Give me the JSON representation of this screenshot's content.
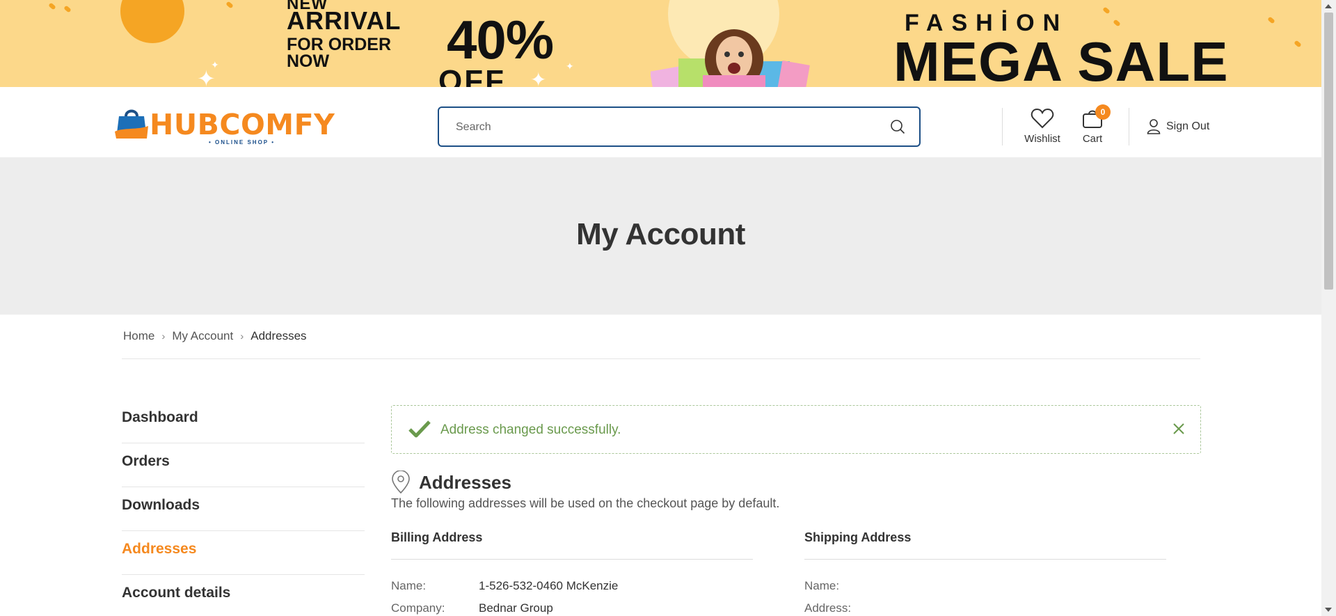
{
  "banner": {
    "new_text": "NEW",
    "arrival_text": "ARRIVAL",
    "for_order_text": "FOR ORDER NOW",
    "percent_text": "40%",
    "off_text": "OFF",
    "fashion_text": "FASHİON",
    "mega_sale_text": "MEGA SALE"
  },
  "header": {
    "brand": "HUBCOMFY",
    "brand_tagline": "• ONLINE SHOP •",
    "search": {
      "placeholder": "Search",
      "value": ""
    },
    "wishlist_label": "Wishlist",
    "cart_label": "Cart",
    "cart_count": "0",
    "signout_label": "Sign Out"
  },
  "page": {
    "title": "My Account"
  },
  "breadcrumb": {
    "home": "Home",
    "my_account": "My Account",
    "current": "Addresses"
  },
  "sidebar": {
    "items": [
      {
        "label": "Dashboard"
      },
      {
        "label": "Orders"
      },
      {
        "label": "Downloads"
      },
      {
        "label": "Addresses"
      },
      {
        "label": "Account details"
      }
    ],
    "active_index": 3
  },
  "alert": {
    "message": "Address changed successfully."
  },
  "addresses": {
    "heading": "Addresses",
    "description": "The following addresses will be used on the checkout page by default.",
    "billing": {
      "title": "Billing Address",
      "rows": [
        {
          "key": "Name:",
          "value": "1-526-532-0460 McKenzie"
        },
        {
          "key": "Company:",
          "value": "Bednar Group"
        }
      ]
    },
    "shipping": {
      "title": "Shipping Address",
      "rows": [
        {
          "key": "Name:",
          "value": ""
        },
        {
          "key": "Address:",
          "value": ""
        }
      ]
    }
  },
  "colors": {
    "accent": "#f5891f",
    "brand_blue": "#1c4f86",
    "banner_bg": "#fcd88a",
    "success": "#6a9a4d"
  }
}
